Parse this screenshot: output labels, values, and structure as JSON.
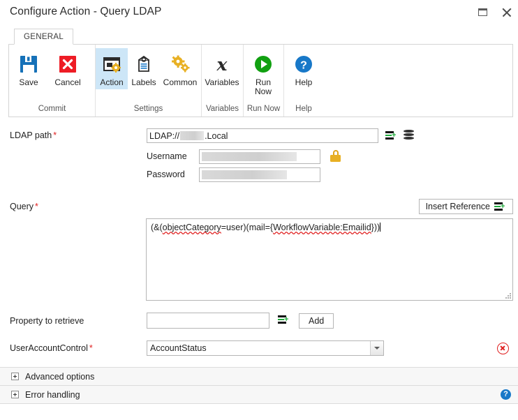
{
  "window": {
    "title": "Configure Action - Query LDAP",
    "restore_tooltip": "Restore",
    "close_tooltip": "Close"
  },
  "ribbon": {
    "tab": "GENERAL",
    "groups": [
      {
        "label": "Commit",
        "items": [
          {
            "caption": "Save",
            "icon": "floppy-disk-icon",
            "selected": false
          },
          {
            "caption": "Cancel",
            "icon": "red-x-icon",
            "selected": false
          }
        ]
      },
      {
        "label": "Settings",
        "items": [
          {
            "caption": "Action",
            "icon": "window-gear-icon",
            "selected": true
          },
          {
            "caption": "Labels",
            "icon": "tag-icon",
            "selected": false
          },
          {
            "caption": "Common",
            "icon": "gears-icon",
            "selected": false
          }
        ]
      },
      {
        "label": "Variables",
        "items": [
          {
            "caption": "Variables",
            "icon": "x-variable-icon",
            "selected": false
          }
        ]
      },
      {
        "label": "Run Now",
        "items": [
          {
            "caption": "Run\nNow",
            "icon": "green-play-icon",
            "selected": false
          }
        ]
      },
      {
        "label": "Help",
        "items": [
          {
            "caption": "Help",
            "icon": "blue-question-icon",
            "selected": false
          }
        ]
      }
    ]
  },
  "form": {
    "ldap_path": {
      "label": "LDAP path",
      "required": true,
      "value_prefix": "LDAP://",
      "value_suffix": ".Local",
      "redacted": true,
      "insert_reference_icon": "insert-reference-icon",
      "browse_directory_icon": "database-stack-icon"
    },
    "username": {
      "label": "Username",
      "value": "",
      "redacted": true,
      "lock_icon": "padlock-icon"
    },
    "password": {
      "label": "Password",
      "value": "",
      "redacted": true
    },
    "query": {
      "label": "Query",
      "required": true,
      "insert_reference_label": "Insert Reference",
      "insert_reference_icon": "insert-reference-icon",
      "value_part1": "(&(",
      "value_spell1": "objectCategory",
      "value_part2": "=user)(mail={",
      "value_spell2": "WorkflowVariable:Emailid",
      "value_part3": "}))",
      "full_value": "(&(objectCategory=user)(mail={WorkflowVariable:Emailid}))"
    },
    "property_to_retrieve": {
      "label": "Property to retrieve",
      "value": "",
      "insert_reference_icon": "insert-reference-icon",
      "add_label": "Add"
    },
    "user_account_control": {
      "label": "UserAccountControl",
      "required": true,
      "selected": "AccountStatus",
      "options": [
        "AccountStatus"
      ],
      "remove_icon": "red-circle-x-icon"
    }
  },
  "sections": [
    {
      "label": "Advanced options",
      "expanded": false,
      "help": false
    },
    {
      "label": "Error handling",
      "expanded": false,
      "help": true
    }
  ],
  "colors": {
    "accent_blue": "#1878c8",
    "save_blue": "#1671b8",
    "cancel_red": "#e02020",
    "gold": "#e8b023",
    "green": "#1faa3c",
    "run_green": "#11a011",
    "selection": "#cde6f7"
  }
}
